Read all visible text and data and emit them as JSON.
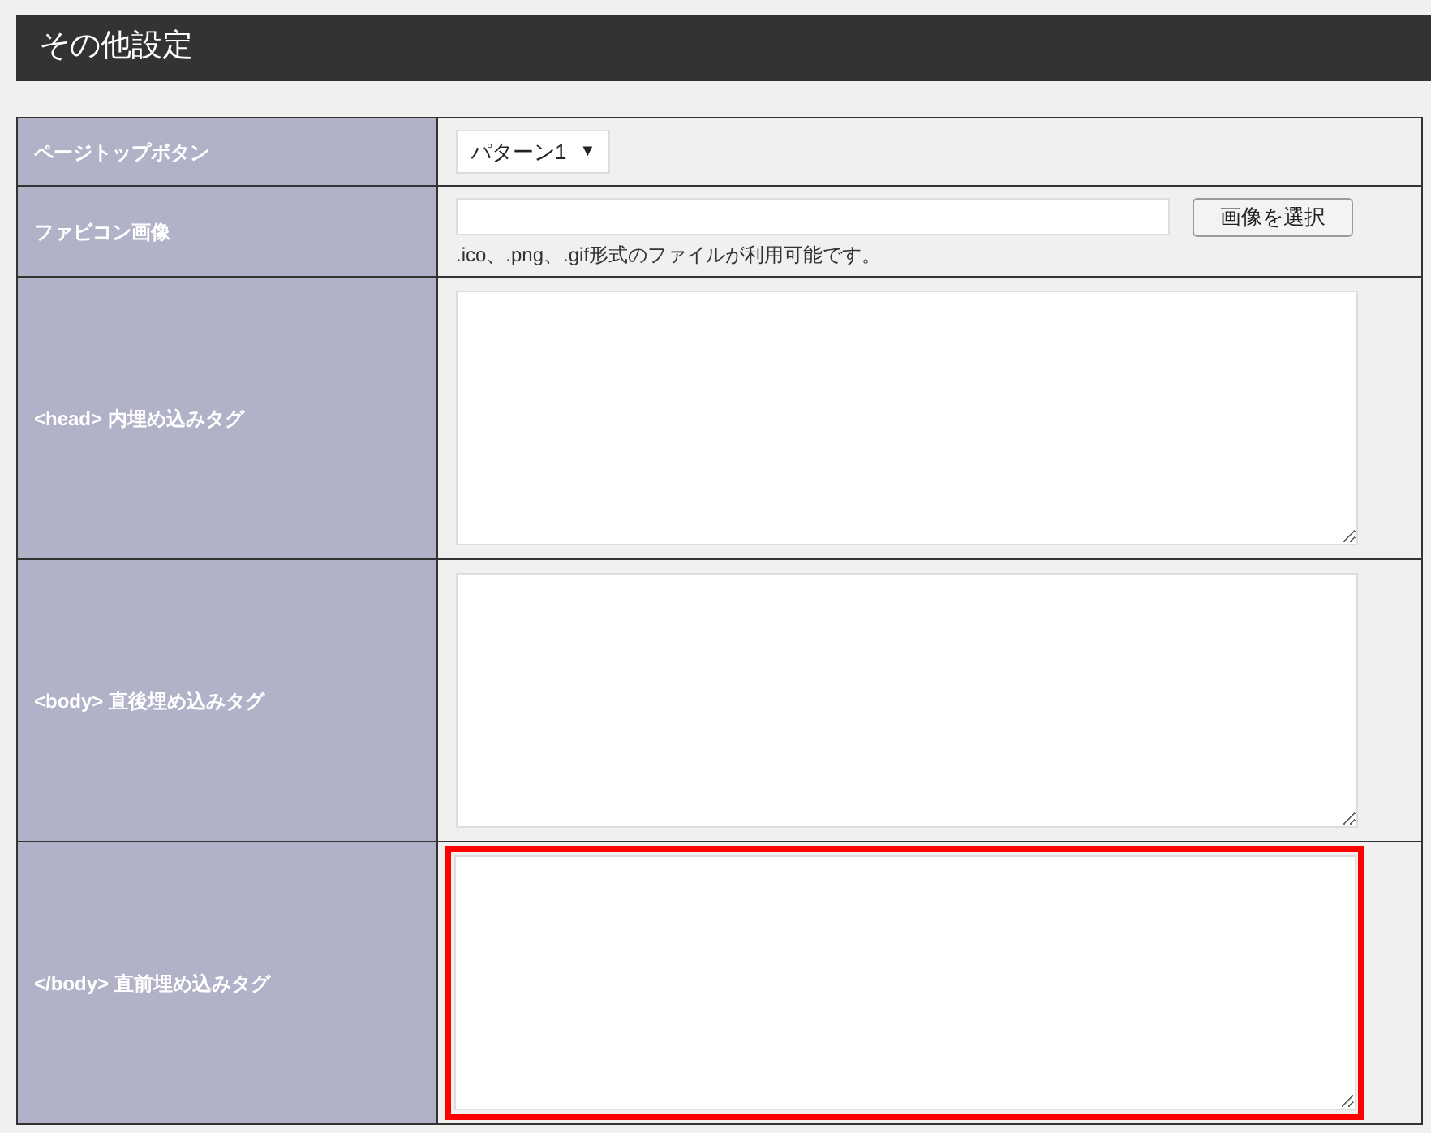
{
  "header": {
    "title": "その他設定"
  },
  "rows": [
    {
      "kind": "select",
      "label": "ページトップボタン",
      "value": "パターン1",
      "arrow": "▼"
    },
    {
      "kind": "file",
      "label": "ファビコン画像",
      "button": "画像を選択",
      "hint": ".ico、.png、.gif形式のファイルが利用可能です。"
    },
    {
      "kind": "textarea",
      "label": "<head> 内埋め込みタグ",
      "highlighted": false
    },
    {
      "kind": "textarea",
      "label": "<body> 直後埋め込みタグ",
      "highlighted": false
    },
    {
      "kind": "textarea",
      "label": "</body> 直前埋め込みタグ",
      "highlighted": true
    }
  ]
}
